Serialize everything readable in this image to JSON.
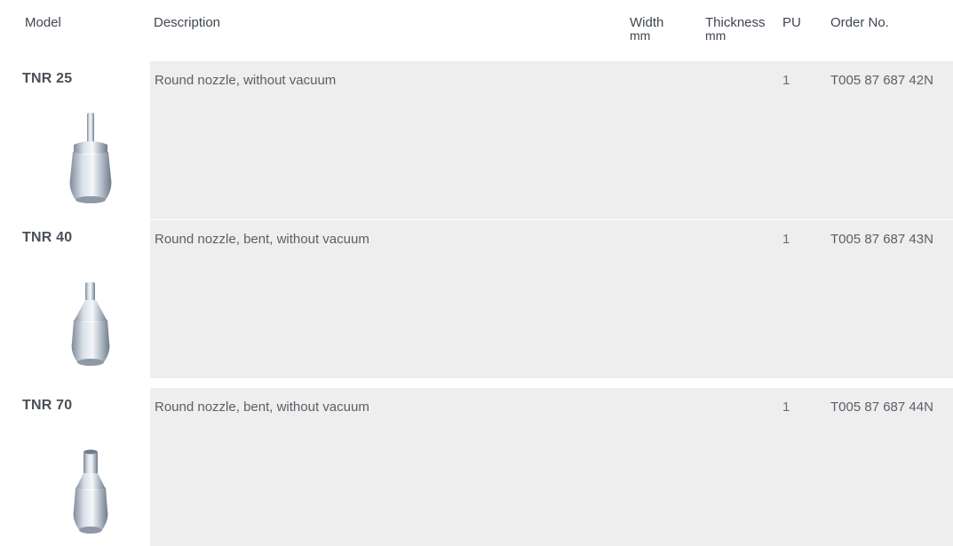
{
  "header": {
    "model": "Model",
    "description": "Description",
    "width": "Width",
    "width_unit": "mm",
    "thickness": "Thickness",
    "thickness_unit": "mm",
    "pu": "PU",
    "order_no": "Order No."
  },
  "rows": [
    {
      "model": "TNR 25",
      "description": "Round nozzle, without vacuum",
      "pu": "1",
      "order_no": "T005 87 687 42N",
      "image_icon": "round-nozzle-icon"
    },
    {
      "model": "TNR 40",
      "description": "Round nozzle, bent, without vacuum",
      "pu": "1",
      "order_no": "T005 87 687 43N",
      "image_icon": "bent-nozzle-icon"
    },
    {
      "model": "TNR 70",
      "description": "Round nozzle, bent, without vacuum",
      "pu": "1",
      "order_no": "T005 87 687 44N",
      "image_icon": "bent-nozzle-icon"
    }
  ],
  "colors": {
    "row_background": "#eeeeee",
    "text": "#444a52",
    "nozzle_metal": "#aab4c0"
  }
}
